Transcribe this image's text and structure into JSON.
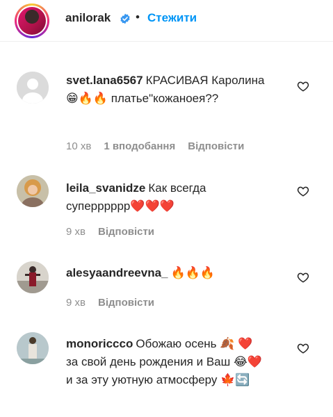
{
  "post": {
    "username": "anilorak",
    "separator": "•",
    "follow_label": "Стежити"
  },
  "comments": [
    {
      "username": "svet.lana6567",
      "text": "КРАСИВАЯ Каролина 😁🔥🔥 платье\"кожаноея??",
      "time": "10 хв",
      "likes": "1 вподобання",
      "reply": "Відповісти"
    },
    {
      "username": "leila_svanidze",
      "text": "Как всегда суперррррр❤️❤️❤️",
      "time": "9 хв",
      "reply": "Відповісти"
    },
    {
      "username": "alesyaandreevna_",
      "text": "🔥🔥🔥",
      "time": "9 хв",
      "reply": "Відповісти"
    },
    {
      "username": "monoriccco",
      "text": "Обожаю осень 🍂 ❤️ за свой день рождения и Ваш 😂❤️ и за эту уютную атмосферу 🍁🔄",
      "time": "",
      "reply": ""
    }
  ],
  "colors": {
    "link_blue": "#0095f6",
    "meta_gray": "#8e8e8e",
    "text": "#262626",
    "heart_red": "#e0245e"
  },
  "icons": [
    "verified-badge-icon",
    "heart-outline-icon"
  ]
}
